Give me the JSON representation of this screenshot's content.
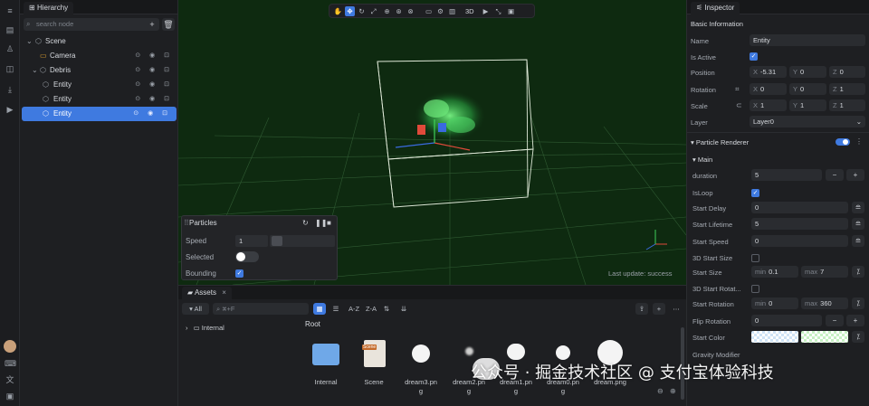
{
  "hierarchy": {
    "tab_label": "Hierarchy",
    "search_placeholder": "search node",
    "nodes": [
      {
        "label": "Scene",
        "icon": "scene-icon"
      },
      {
        "label": "Camera",
        "icon": "camera-icon"
      },
      {
        "label": "Debris",
        "icon": "node-icon"
      },
      {
        "label": "Entity",
        "icon": "node-icon"
      },
      {
        "label": "Entity",
        "icon": "node-icon"
      },
      {
        "label": "Entity",
        "icon": "node-icon",
        "selected": true
      }
    ]
  },
  "viewport": {
    "toolbar_3d": "3D",
    "status": "Last update: success"
  },
  "particles_panel": {
    "title": "Particles",
    "speed_label": "Speed",
    "speed_value": "1",
    "selected_label": "Selected",
    "bounding_label": "Bounding"
  },
  "assets": {
    "tab_label": "Assets",
    "filter_label": "All",
    "search_placeholder": "⌘+F",
    "sort_az": "A-Z",
    "sort_za": "Z-A",
    "folder": "Internal",
    "root_label": "Root",
    "items": [
      {
        "name": "Internal",
        "kind": "folder"
      },
      {
        "name": "Scene",
        "kind": "scene",
        "badge": "Scene"
      },
      {
        "name": "dream3.pn\ng",
        "kind": "image"
      },
      {
        "name": "dream2.pn\ng",
        "kind": "image"
      },
      {
        "name": "dream1.pn\ng",
        "kind": "image"
      },
      {
        "name": "dream0.pn\ng",
        "kind": "image"
      },
      {
        "name": "dream.png",
        "kind": "image"
      }
    ]
  },
  "inspector": {
    "tab_label": "Inspector",
    "basic_info": "Basic Information",
    "name_label": "Name",
    "name_value": "Entity",
    "is_active_label": "Is Active",
    "position_label": "Position",
    "position": {
      "x": "-5.31",
      "y": "0",
      "z": "0"
    },
    "rotation_label": "Rotation",
    "rotation": {
      "x": "0",
      "y": "0",
      "z": "1"
    },
    "scale_label": "Scale",
    "scale": {
      "x": "1",
      "y": "1",
      "z": "1"
    },
    "layer_label": "Layer",
    "layer_value": "Layer0",
    "particle_renderer": "Particle Renderer",
    "main_label": "Main",
    "duration_label": "duration",
    "duration_value": "5",
    "isloop_label": "IsLoop",
    "start_delay_label": "Start Delay",
    "start_delay_value": "0",
    "start_lifetime_label": "Start Lifetime",
    "start_lifetime_value": "5",
    "start_speed_label": "Start Speed",
    "start_speed_value": "0",
    "start_size_3d_label": "3D Start Size",
    "start_size_label": "Start Size",
    "start_size_min": "0.1",
    "start_size_max": "7",
    "start_rotation_3d_label": "3D Start Rotat...",
    "start_rotation_label": "Start Rotation",
    "start_rotation_min": "0",
    "start_rotation_max": "360",
    "flip_rotation_label": "Flip Rotation",
    "flip_rotation_value": "0",
    "start_color_label": "Start Color",
    "gravity_label": "Gravity Modifier",
    "min_label": "min",
    "max_label": "max"
  },
  "watermark": {
    "line": "公众号 · 掘金技术社区 @ 支付宝体验科技"
  },
  "colors": {
    "accent": "#3f7ae0",
    "viewport_bg": "#0e2a10",
    "panel_bg": "#1e1f22"
  }
}
